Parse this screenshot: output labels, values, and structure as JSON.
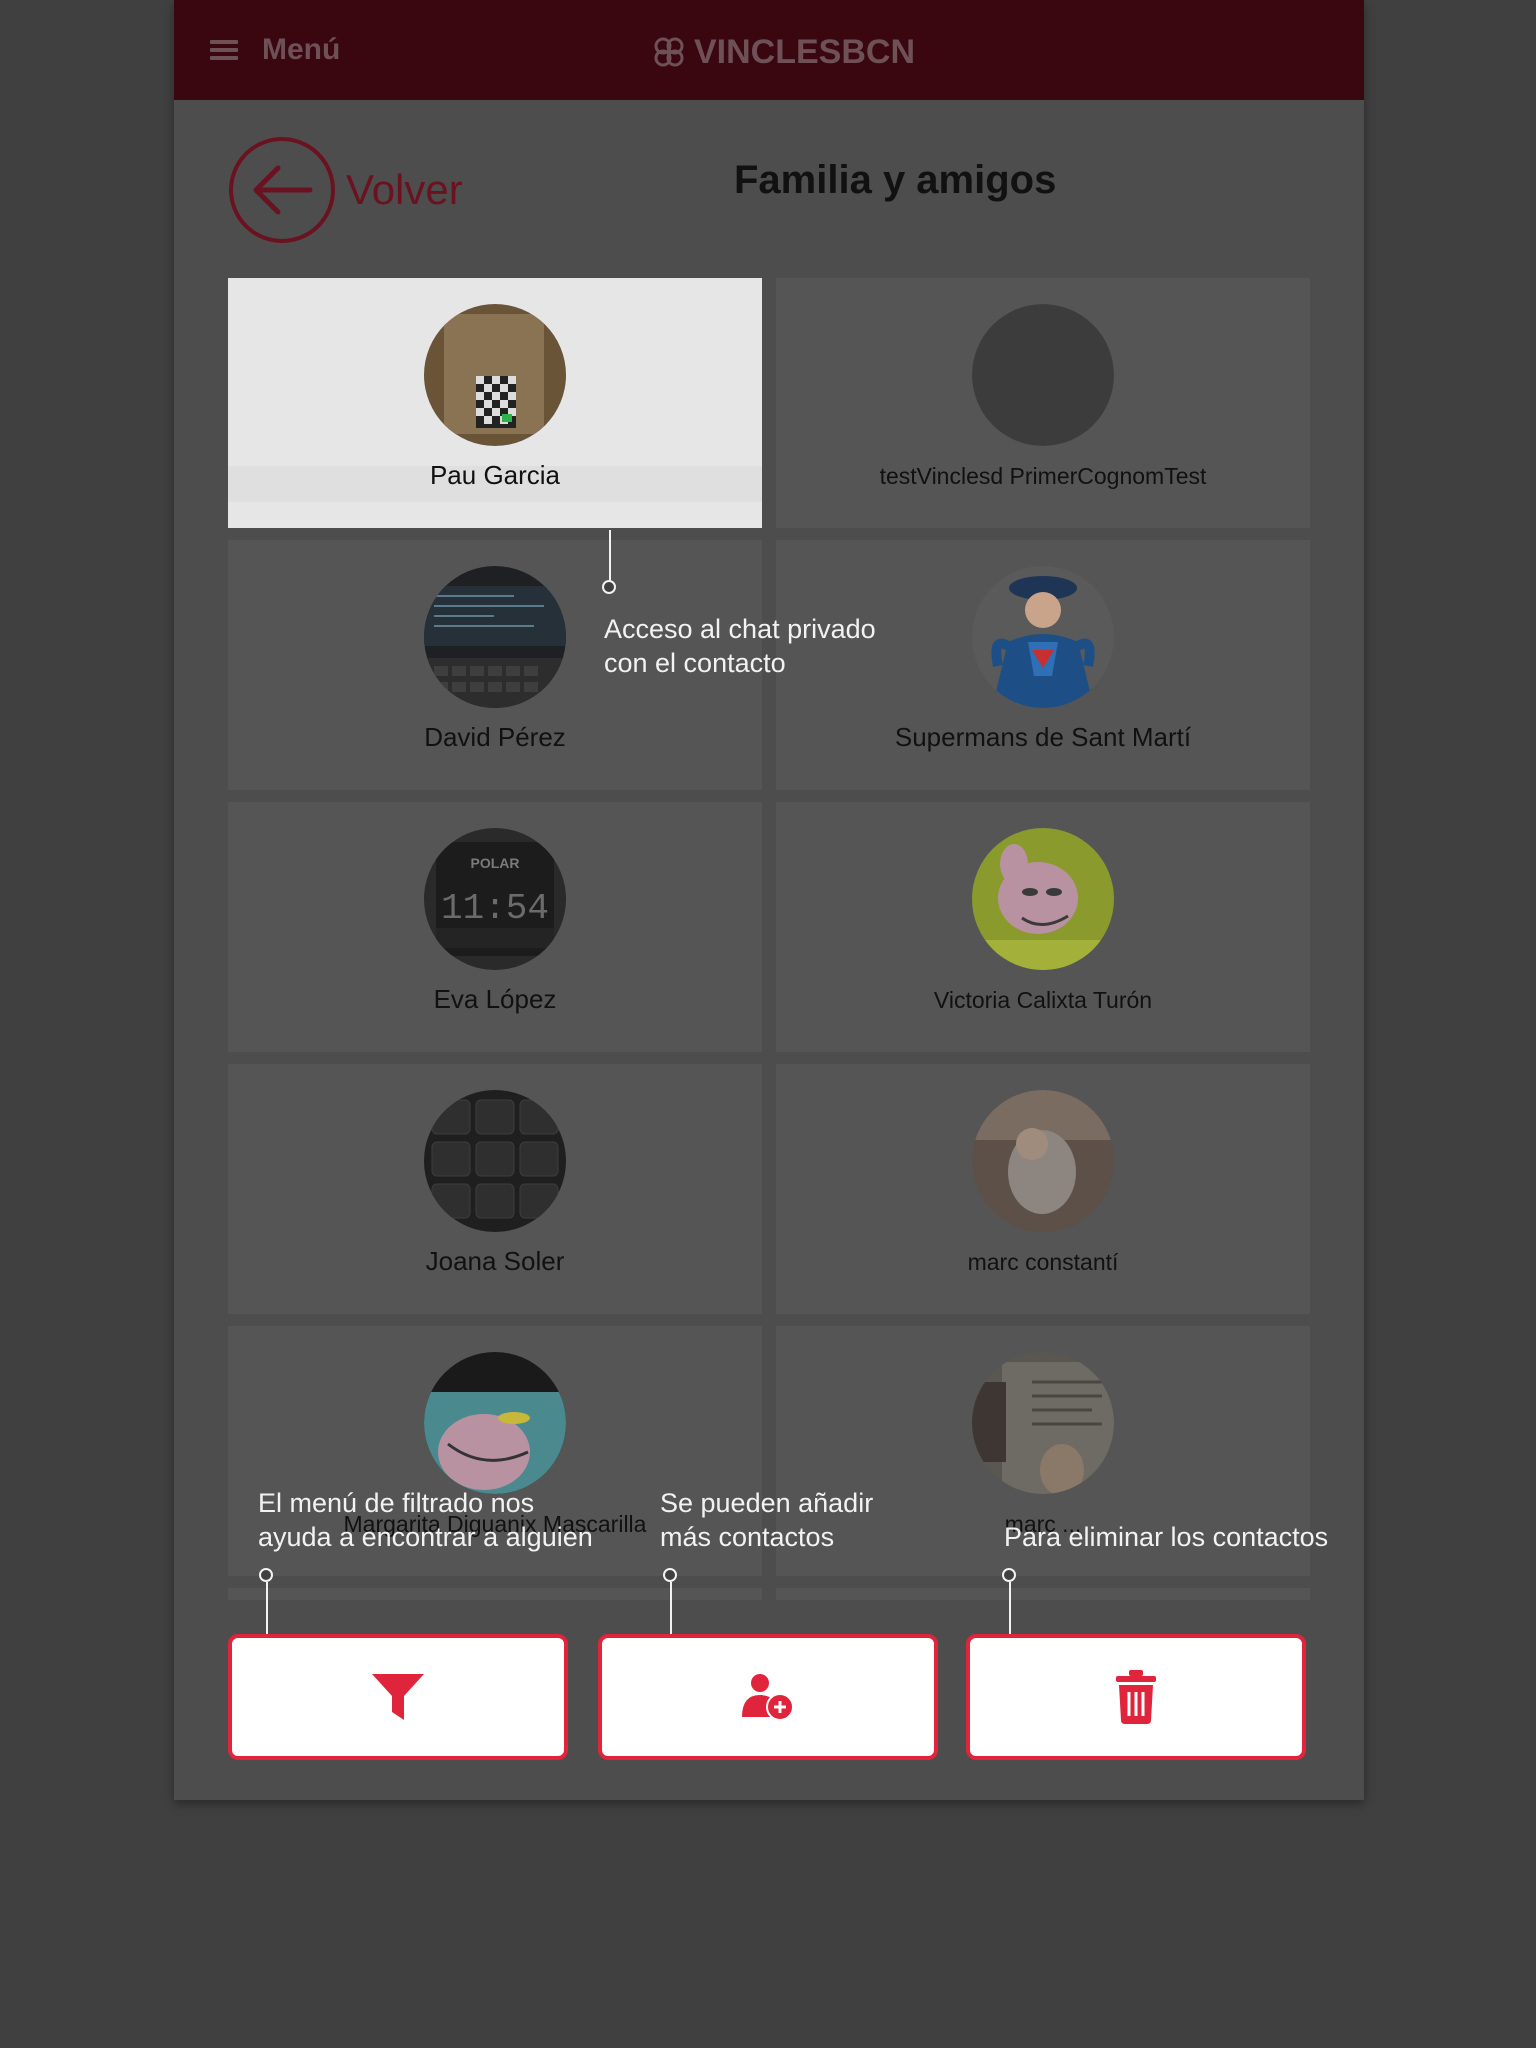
{
  "topbar": {
    "menu_label": "Menú",
    "brand_name": "VINCLESBCN",
    "bar_color": "#3a0710"
  },
  "header": {
    "back_label": "Volver",
    "title": "Familia y amigos"
  },
  "contacts": [
    {
      "name": "Pau Garcia",
      "avatar": "checkerboard-photo",
      "highlighted": true
    },
    {
      "name": "testVinclesd PrimerCognomTest",
      "avatar": "blank-avatar"
    },
    {
      "name": "David Pérez",
      "avatar": "laptop-photo"
    },
    {
      "name": "Supermans de Sant Martí",
      "avatar": "superman-cartoon"
    },
    {
      "name": "Eva López",
      "avatar": "watch-photo"
    },
    {
      "name": "Victoria Calixta Turón",
      "avatar": "pink-panther-cartoon"
    },
    {
      "name": "Joana Soler",
      "avatar": "keyboard-photo"
    },
    {
      "name": "marc constantí",
      "avatar": "baby-photo"
    },
    {
      "name": "Margarita Diguanix Mascarilla",
      "avatar": "pink-panther-cartoon"
    },
    {
      "name": "marc ...",
      "avatar": "newspaper-photo"
    }
  ],
  "callouts": {
    "chat": [
      "Acceso al chat privado",
      "con el contacto"
    ],
    "filter": [
      "El menú de filtrado nos",
      "ayuda a encontrar a alguien"
    ],
    "add": [
      "Se pueden añadir",
      "más contactos"
    ],
    "delete": [
      "Para eliminar los contactos"
    ]
  },
  "actions": {
    "filter_icon": "filter-icon",
    "add_icon": "add-user-icon",
    "delete_icon": "trash-icon",
    "accent": "#e0243c"
  }
}
